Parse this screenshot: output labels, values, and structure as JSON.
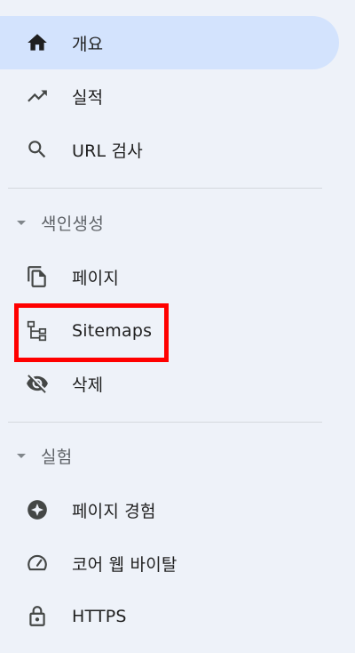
{
  "nav": {
    "overview": {
      "label": "개요",
      "icon": "home-icon"
    },
    "performance": {
      "label": "실적",
      "icon": "trending-up-icon"
    },
    "url_inspection": {
      "label": "URL 검사",
      "icon": "search-icon"
    },
    "indexing_section": {
      "label": "색인생성",
      "icon": "caret-down-icon"
    },
    "pages": {
      "label": "페이지",
      "icon": "copy-pages-icon"
    },
    "sitemaps": {
      "label": "Sitemaps",
      "icon": "sitemap-icon"
    },
    "removals": {
      "label": "삭제",
      "icon": "eye-off-icon"
    },
    "experience_section": {
      "label": "실험",
      "icon": "caret-down-icon"
    },
    "page_experience": {
      "label": "페이지 경험",
      "icon": "star-badge-icon"
    },
    "core_web_vitals": {
      "label": "코어 웹 바이탈",
      "icon": "speedometer-icon"
    },
    "https": {
      "label": "HTTPS",
      "icon": "lock-icon"
    }
  },
  "colors": {
    "background": "#eef2f9",
    "active_background": "#d3e3fd",
    "highlight_border": "#ff0000",
    "icon": "#444746",
    "section_text": "#5f6368"
  }
}
